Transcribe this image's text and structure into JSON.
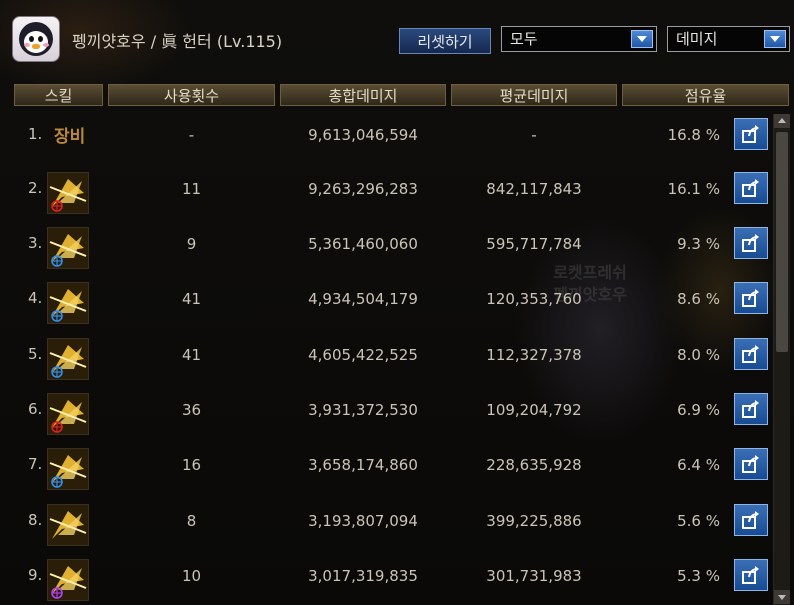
{
  "header": {
    "character_name": "펭끼얏호우",
    "separator": "/",
    "class_symbol": "眞",
    "class_name": "헌터",
    "level_text": "(Lv.115)",
    "reset_button": "리셋하기",
    "filter_dropdown": "모두",
    "metric_dropdown": "데미지"
  },
  "watermark": {
    "line1": "로켓프레쉬",
    "line2": "펭끼얏호우"
  },
  "columns": [
    "스킬",
    "사용횟수",
    "총합데미지",
    "평균데미지",
    "점유율"
  ],
  "rows": [
    {
      "index": "1.",
      "skill_label": "장비",
      "icon": "equipment-label",
      "uses": "-",
      "total": "9,613,046,594",
      "average": "-",
      "share": "16.8 %"
    },
    {
      "index": "2.",
      "icon": "skill-slash-red-icon",
      "uses": "11",
      "total": "9,263,296,283",
      "average": "842,117,843",
      "share": "16.1 %"
    },
    {
      "index": "3.",
      "icon": "skill-eye-blue-icon",
      "uses": "9",
      "total": "5,361,460,060",
      "average": "595,717,784",
      "share": "9.3 %"
    },
    {
      "index": "4.",
      "icon": "skill-burst-blue-icon",
      "uses": "41",
      "total": "4,934,504,179",
      "average": "120,353,760",
      "share": "8.6 %"
    },
    {
      "index": "5.",
      "icon": "skill-claw-blue-icon",
      "uses": "41",
      "total": "4,605,422,525",
      "average": "112,327,378",
      "share": "8.0 %"
    },
    {
      "index": "6.",
      "icon": "skill-arrow-red-icon",
      "uses": "36",
      "total": "3,931,372,530",
      "average": "109,204,792",
      "share": "6.9 %"
    },
    {
      "index": "7.",
      "icon": "skill-wing-blue-icon",
      "uses": "16",
      "total": "3,658,174,860",
      "average": "228,635,928",
      "share": "6.4 %"
    },
    {
      "index": "8.",
      "icon": "skill-wave-icon",
      "uses": "8",
      "total": "3,193,807,094",
      "average": "399,225,886",
      "share": "5.6 %"
    },
    {
      "index": "9.",
      "icon": "skill-star-purple-icon",
      "uses": "10",
      "total": "3,017,319,835",
      "average": "301,731,983",
      "share": "5.3 %"
    }
  ],
  "colors": {
    "header_gold": "#5a4d34",
    "button_blue": "#1f57a6",
    "text": "#c9c4b6",
    "skill_gold": "#e0b030"
  }
}
